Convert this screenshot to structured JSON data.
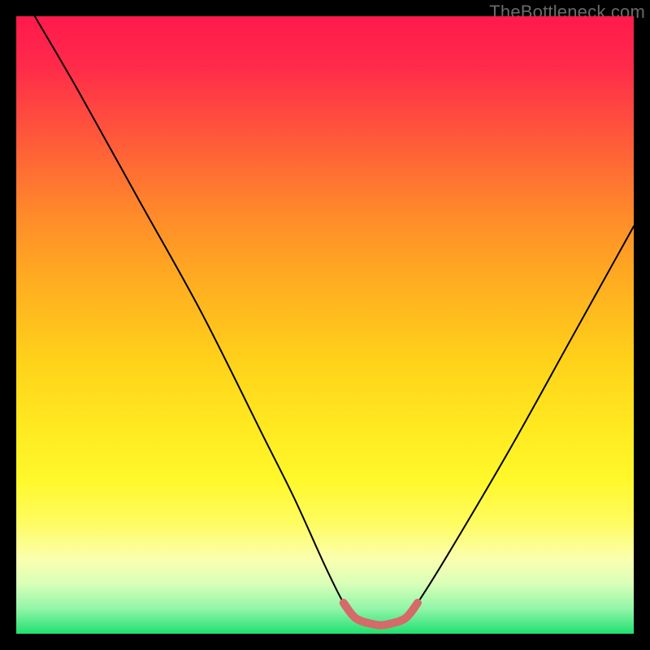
{
  "watermark": "TheBottleneck.com",
  "chart_data": {
    "type": "line",
    "title": "",
    "xlabel": "",
    "ylabel": "",
    "xlim": [
      0,
      100
    ],
    "ylim": [
      0,
      100
    ],
    "grid": false,
    "legend": false,
    "annotations": [],
    "series": [
      {
        "name": "main-curve",
        "color": "#000000",
        "stroke_width": 2,
        "x": [
          3,
          10,
          20,
          30,
          40,
          45,
          50,
          53,
          55,
          58,
          60,
          63,
          65,
          70,
          80,
          90,
          100
        ],
        "y": [
          100,
          88,
          70,
          52,
          32,
          22,
          11,
          5,
          2.5,
          1.5,
          1.5,
          2.5,
          5,
          13,
          30,
          48,
          66
        ]
      },
      {
        "name": "bottom-marker",
        "color": "#d46a6a",
        "stroke_width": 10,
        "x": [
          53,
          55,
          58,
          60,
          63,
          65
        ],
        "y": [
          5,
          2.5,
          1.5,
          1.5,
          2.5,
          5
        ]
      }
    ]
  }
}
